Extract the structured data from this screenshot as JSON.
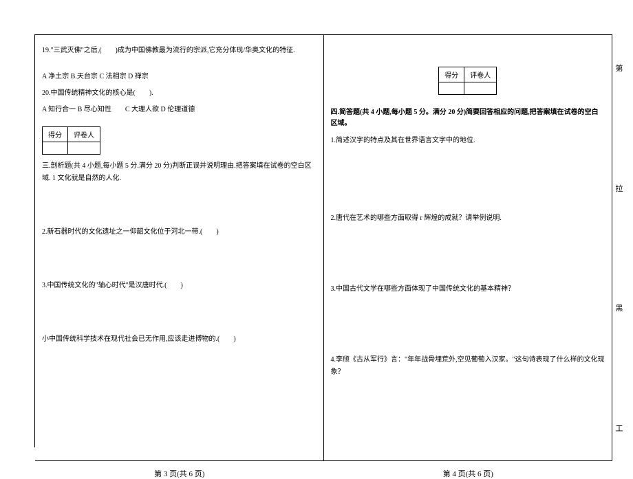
{
  "left": {
    "q19": "19.\"三武灭佛\"之后,(　　)成为中国佛教最为流行的宗派,它充分体现/华奥文化的特征.",
    "q19_options": "A 净土宗 B.天台宗 C 法相宗 D 禅宗",
    "q20": "20.中国传统精神文化的核心是(　　).",
    "q20_options": "A 知行合一 B 尽心知性　　C 大理人欲 D 伦理道德",
    "score_label1": "得分",
    "score_label2": "评卷人",
    "section3_header": "三.剖析题(共 4 小题,每小题 5 分.满分 20 分)判断正误并说明理由.把答案填在试卷的空白区域. 1 文化就是自然的人化.",
    "q3_2": "2.新石器时代的文化遗址之一仰韶文化位于河北一带.(　　)",
    "q3_3": "3.中国传统文化的\"轴心时代\"是汉唐时代.(　　)",
    "q3_4": "小中国传统科学技术在现代社会已无作用,应该走进博物的.(　　)",
    "page_num": "第 3 页(共 6 页)"
  },
  "right": {
    "score_label1": "得分",
    "score_label2": "评卷人",
    "section4_header": "四.简答题(共 4 小题,每小题 5 分。满分 20 分)简要回答相应的问题,把答案填在试卷的空白区域。",
    "q4_1": "1.简述汉字的特点及其在世界语言文字中的地位.",
    "q4_2": "2.唐代在艺术的哪些方面取得 r 辉煌的成就？请举例说明.",
    "q4_3": "3.中国古代文学在哪些方面体现了中国传统文化的基本精神？",
    "q4_4": "4.李颀《古从军行》言：\"年年战骨埋荒外,空见葡萄入汉家。\"这句诗表现了什么样的文化现象？",
    "page_num": "第 4 页(共 6 页)",
    "marker1": "第",
    "marker2": "拉",
    "marker3": "黑",
    "marker4": "工"
  }
}
